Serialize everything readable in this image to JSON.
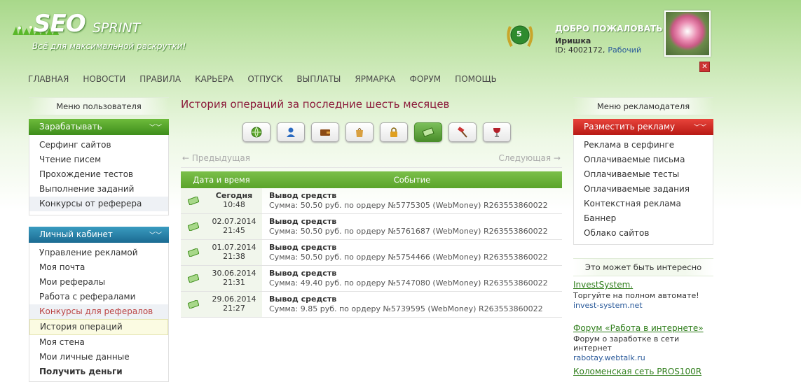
{
  "header": {
    "logo_seo": "SEO",
    "logo_sprint": "SPRINT",
    "tagline": "Всё для максимальной раскрутки!",
    "badge_level": "5",
    "welcome_title": "ДОБРО ПОЖАЛОВАТЬ",
    "user_name": "Иришка",
    "user_id_label": "ID: 4002172,",
    "user_status": "Рабочий"
  },
  "nav": [
    "ГЛАВНАЯ",
    "НОВОСТИ",
    "ПРАВИЛА",
    "КАРЬЕРА",
    "ОТПУСК",
    "ВЫПЛАТЫ",
    "ЯРМАРКА",
    "ФОРУМ",
    "ПОМОЩЬ"
  ],
  "left_menu": {
    "title": "Меню пользователя",
    "earn": {
      "header": "Зарабатывать",
      "items": [
        "Серфинг сайтов",
        "Чтение писем",
        "Прохождение тестов",
        "Выполнение заданий",
        "Конкурсы от реферера"
      ]
    },
    "cabinet": {
      "header": "Личный кабинет",
      "items": [
        "Управление рекламой",
        "Моя почта",
        "Мои рефералы",
        "Работа с рефералами",
        "Конкурсы для рефералов",
        "История операций",
        "Моя стена",
        "Мои личные данные",
        "Получить деньги"
      ]
    }
  },
  "main": {
    "title": "История операций за последние шесть месяцев",
    "categories": [
      "globe-icon",
      "user-icon",
      "wallet-icon",
      "shopping-bag-icon",
      "lock-icon",
      "money-icon",
      "hammer-icon",
      "wine-glass-icon"
    ],
    "active_category": 5,
    "pager_prev": "← Предыдущая",
    "pager_next": "Следующая →",
    "table": {
      "col_date": "Дата и время",
      "col_event": "Событие",
      "rows": [
        {
          "date": "Сегодня",
          "time": "10:48",
          "event": "Вывод средств",
          "detail": "Сумма: 50.50 руб. по ордеру №5775305 (WebMoney) R263553860022"
        },
        {
          "date": "02.07.2014",
          "time": "21:45",
          "event": "Вывод средств",
          "detail": "Сумма: 50.50 руб. по ордеру №5761687 (WebMoney) R263553860022"
        },
        {
          "date": "01.07.2014",
          "time": "21:38",
          "event": "Вывод средств",
          "detail": "Сумма: 50.50 руб. по ордеру №5754466 (WebMoney) R263553860022"
        },
        {
          "date": "30.06.2014",
          "time": "21:31",
          "event": "Вывод средств",
          "detail": "Сумма: 49.40 руб. по ордеру №5747080 (WebMoney) R263553860022"
        },
        {
          "date": "29.06.2014",
          "time": "21:27",
          "event": "Вывод средств",
          "detail": "Сумма: 9.85 руб. по ордеру №5739595 (WebMoney) R263553860022"
        }
      ]
    }
  },
  "right_menu": {
    "title": "Меню рекламодателя",
    "header": "Разместить рекламу",
    "items": [
      "Реклама в серфинге",
      "Оплачиваемые письма",
      "Оплачиваемые тесты",
      "Оплачиваемые задания",
      "Контекстная реклама",
      "Баннер",
      "Облако сайтов"
    ]
  },
  "interesting": {
    "title": "Это может быть интересно",
    "items": [
      {
        "title": "InvestSystem.",
        "desc": "Торгуйте на полном автомате!",
        "url": "invest-system.net"
      },
      {
        "title": "Форум «Работа в интернете»",
        "desc": "Форум о заработке в сети интернет",
        "url": "rabotay.webtalk.ru"
      },
      {
        "title": "Коломенская сеть PROS100R",
        "desc": "",
        "url": ""
      }
    ]
  },
  "colors": {
    "header_green": "#a8d88a",
    "accent_green": "#5aa42a",
    "accent_blue": "#1b6b92",
    "accent_red": "#c41f18",
    "title_maroon": "#8b1a3a"
  }
}
